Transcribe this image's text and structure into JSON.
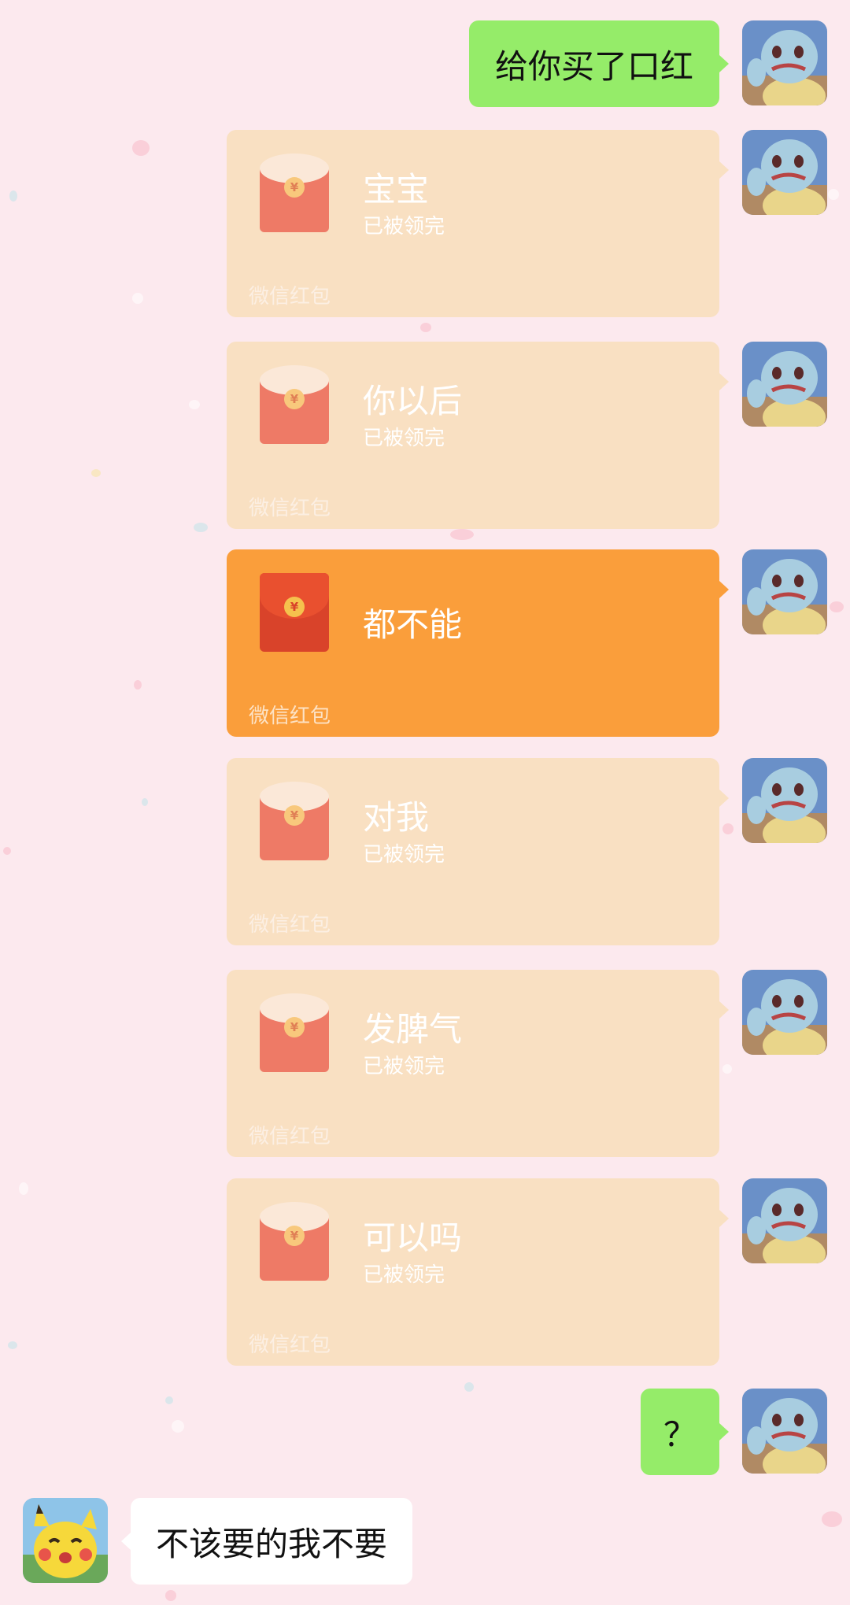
{
  "messages": {
    "lipstick": "给你买了口红",
    "question": "？",
    "reply": "不该要的我不要"
  },
  "red_packets": [
    {
      "title": "宝宝",
      "status": "已被领完",
      "footer": "微信红包",
      "coin": "¥"
    },
    {
      "title": "你以后",
      "status": "已被领完",
      "footer": "微信红包",
      "coin": "¥"
    },
    {
      "title": "都不能",
      "status": "",
      "footer": "微信红包",
      "coin": "¥"
    },
    {
      "title": "对我",
      "status": "已被领完",
      "footer": "微信红包",
      "coin": "¥"
    },
    {
      "title": "发脾气",
      "status": "已被领完",
      "footer": "微信红包",
      "coin": "¥"
    },
    {
      "title": "可以吗",
      "status": "已被领完",
      "footer": "微信红包",
      "coin": "¥"
    }
  ],
  "avatars": {
    "me": "squirtle-avatar",
    "other": "pikachu-avatar"
  },
  "colors": {
    "background": "#fce9ee",
    "sent_bubble": "#95ec69",
    "received_bubble": "#ffffff",
    "packet_claimed": "#f9e0c2",
    "packet_active": "#fa9e3b"
  }
}
